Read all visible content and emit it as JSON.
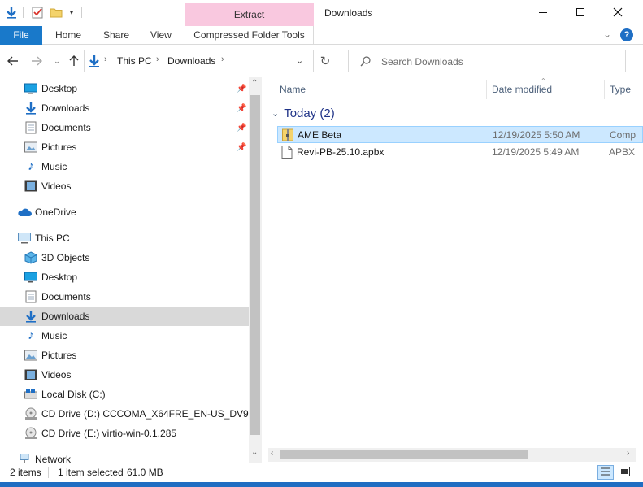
{
  "window": {
    "title": "Downloads",
    "context_tab_top": "Extract",
    "minimize_icon": "minimize-icon",
    "maximize_icon": "maximize-icon",
    "close_icon": "close-icon"
  },
  "ribbon": {
    "file": "File",
    "home": "Home",
    "share": "Share",
    "view": "View",
    "compressed_tools": "Compressed Folder Tools"
  },
  "address": {
    "crumbs": [
      "This PC",
      "Downloads"
    ],
    "search_placeholder": "Search Downloads"
  },
  "nav": {
    "quick_access": [
      {
        "label": "Desktop",
        "icon": "desktop-icon"
      },
      {
        "label": "Downloads",
        "icon": "downloads-icon"
      },
      {
        "label": "Documents",
        "icon": "documents-icon"
      },
      {
        "label": "Pictures",
        "icon": "pictures-icon"
      },
      {
        "label": "Music",
        "icon": "music-icon"
      },
      {
        "label": "Videos",
        "icon": "videos-icon"
      }
    ],
    "onedrive": "OneDrive",
    "this_pc": "This PC",
    "pc_items": [
      {
        "label": "3D Objects"
      },
      {
        "label": "Desktop"
      },
      {
        "label": "Documents"
      },
      {
        "label": "Downloads"
      },
      {
        "label": "Music"
      },
      {
        "label": "Pictures"
      },
      {
        "label": "Videos"
      },
      {
        "label": "Local Disk (C:)"
      },
      {
        "label": "CD Drive (D:) CCCOMA_X64FRE_EN-US_DV9"
      },
      {
        "label": "CD Drive (E:) virtio-win-0.1.285"
      }
    ],
    "network": "Network"
  },
  "content": {
    "columns": {
      "name": "Name",
      "date": "Date modified",
      "type": "Type"
    },
    "group": "Today (2)",
    "files": [
      {
        "name": "AME Beta",
        "date": "12/19/2025 5:50 AM",
        "type": "Comp",
        "icon": "zip-folder-icon",
        "selected": true
      },
      {
        "name": "Revi-PB-25.10.apbx",
        "date": "12/19/2025 5:49 AM",
        "type": "APBX",
        "icon": "file-icon",
        "selected": false
      }
    ]
  },
  "status": {
    "items": "2 items",
    "selected": "1 item selected",
    "size": "61.0 MB"
  },
  "colors": {
    "accent": "#1979ca",
    "context_tab": "#f9c8df",
    "selection": "#cce8ff",
    "group_header": "#1e3287"
  }
}
